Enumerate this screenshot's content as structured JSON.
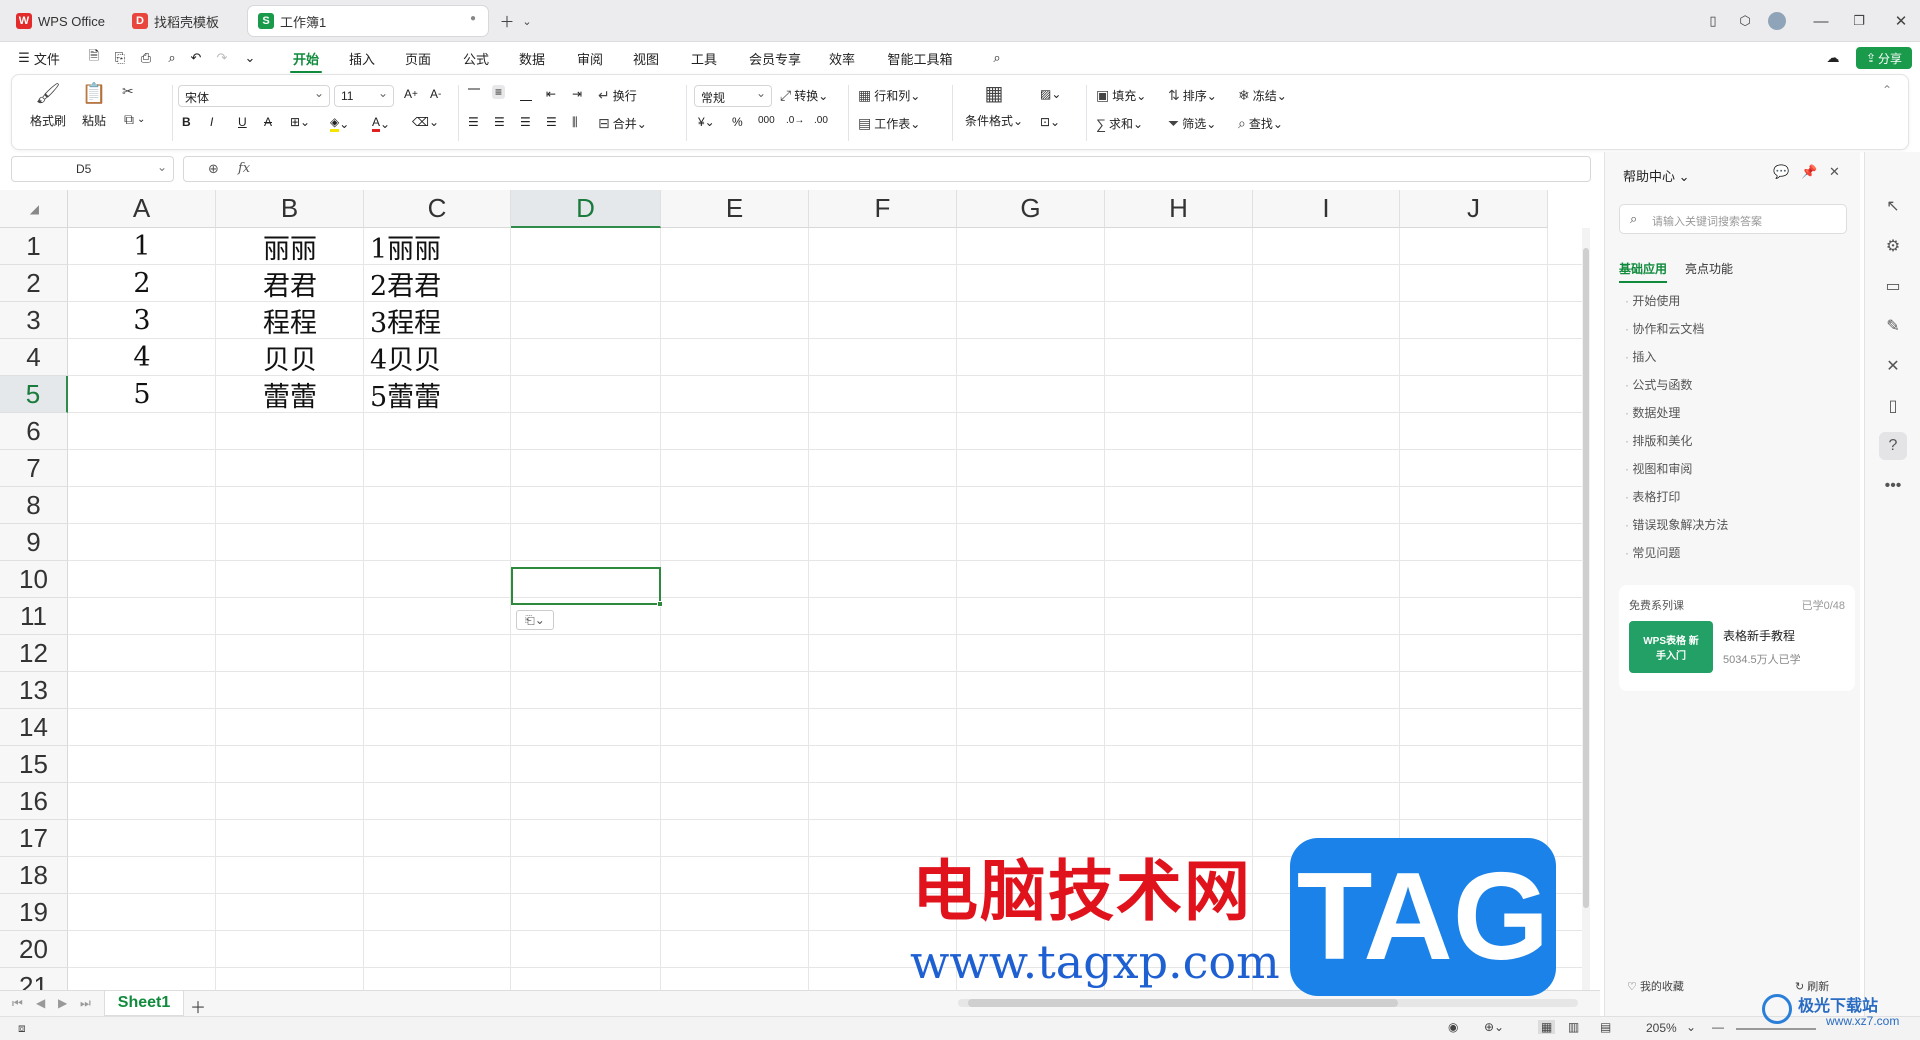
{
  "tabs": [
    {
      "label": "WPS Office",
      "icon": "wps-logo-icon"
    },
    {
      "label": "找稻壳模板",
      "icon": "docer-logo-icon"
    },
    {
      "label": "工作簿1",
      "icon": "spreadsheet-logo-icon"
    }
  ],
  "menu": {
    "file": "文件",
    "items": [
      "开始",
      "插入",
      "页面",
      "公式",
      "数据",
      "审阅",
      "视图",
      "工具",
      "会员专享",
      "效率",
      "智能工具箱"
    ],
    "active": "开始",
    "share": "分享"
  },
  "ribbon": {
    "format_painter": "格式刷",
    "paste": "粘贴",
    "font": "宋体",
    "size": "11",
    "wrap": "换行",
    "merge": "合并",
    "number_format": "常规",
    "convert": "转换",
    "rows_cols": "行和列",
    "worksheet": "工作表",
    "cond_format": "条件格式",
    "fill": "填充",
    "sort": "排序",
    "freeze": "冻结",
    "sum": "求和",
    "filter": "筛选",
    "find": "查找"
  },
  "formula_bar": {
    "name_box": "D5",
    "fx": "fx"
  },
  "columns": [
    "A",
    "B",
    "C",
    "D",
    "E",
    "F",
    "G",
    "H",
    "I",
    "J"
  ],
  "selected_column": "D",
  "rows": [
    "1",
    "2",
    "3",
    "4",
    "5",
    "6",
    "7",
    "8",
    "9",
    "10",
    "11",
    "12",
    "13",
    "14",
    "15",
    "16",
    "17",
    "18",
    "19",
    "20",
    "21"
  ],
  "selected_row": "5",
  "cells": {
    "A": [
      "1",
      "2",
      "3",
      "4",
      "5"
    ],
    "B": [
      "丽丽",
      "君君",
      "程程",
      "贝贝",
      "蕾蕾"
    ],
    "C": [
      "1丽丽",
      "2君君",
      "3程程",
      "4贝贝",
      "5蕾蕾"
    ]
  },
  "sheet_tab": "Sheet1",
  "status": {
    "zoom": "205%"
  },
  "help_panel": {
    "title": "帮助中心",
    "search_placeholder": "请输入关键词搜索答案",
    "tabs": [
      "基础应用",
      "亮点功能"
    ],
    "items": [
      "开始使用",
      "协作和云文档",
      "插入",
      "公式与函数",
      "数据处理",
      "排版和美化",
      "视图和审阅",
      "表格打印",
      "错误现象解决方法",
      "常见问题"
    ],
    "course_header": "免费系列课",
    "course_progress": "已学0/48",
    "course_thumb": "WPS表格 新手入门",
    "course_title": "表格新手教程",
    "course_learners": "5034.5万人已学",
    "favorites": "我的收藏",
    "refresh": "刷新"
  },
  "watermark": {
    "title": "电脑技术网",
    "url": "www.tagxp.com",
    "logo": "TAG",
    "corner": "极光下载站",
    "corner_url": "www.xz7.com"
  },
  "colors": {
    "accent": "#108b3c",
    "selection": "#2d8a3d",
    "tag_blue": "#1a82e8",
    "watermark_red": "#e0121c"
  }
}
